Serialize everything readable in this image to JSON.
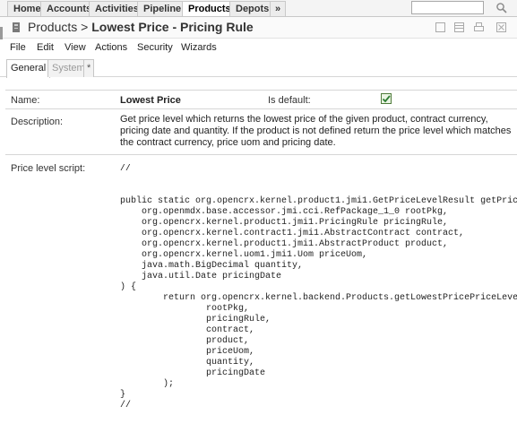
{
  "nav": {
    "tabs": [
      "Home",
      "Accounts",
      "Activities",
      "Pipeline",
      "Products",
      "Depots",
      "»"
    ],
    "active": "Products",
    "search_value": ""
  },
  "header": {
    "breadcrumb_parent": "Products",
    "separator": ">",
    "title": "Lowest Price - Pricing Rule"
  },
  "menu": {
    "items": [
      "File",
      "Edit",
      "View",
      "Actions",
      "Security",
      "Wizards"
    ]
  },
  "subtabs": {
    "items": [
      "General",
      "System",
      "*"
    ],
    "active": "General"
  },
  "fields": {
    "name_label": "Name:",
    "name_value": "Lowest Price",
    "is_default_label": "Is default:",
    "is_default_checked": true,
    "description_label": "Description:",
    "description_value": "Get price level which returns the lowest price of the given product, contract currency, pricing date and quantity. If the product is not defined return the price level which matches the contract currency, price uom and pricing date.",
    "script_label": "Price level script:",
    "script_value": "//\n\n\npublic static org.opencrx.kernel.product1.jmi1.GetPriceLevelResult getPriceLevel(\n    org.openmdx.base.accessor.jmi.cci.RefPackage_1_0 rootPkg,\n    org.opencrx.kernel.product1.jmi1.PricingRule pricingRule,\n    org.opencrx.kernel.contract1.jmi1.AbstractContract contract,\n    org.opencrx.kernel.product1.jmi1.AbstractProduct product,\n    org.opencrx.kernel.uom1.jmi1.Uom priceUom,\n    java.math.BigDecimal quantity,\n    java.util.Date pricingDate\n) {\n        return org.opencrx.kernel.backend.Products.getLowestPricePriceLevel(\n                rootPkg,\n                pricingRule,\n                contract,\n                product,\n                priceUom,\n                quantity,\n                pricingDate\n        );\n}\n//"
  },
  "colors": {
    "accent_check": "#2e7d32",
    "border": "#d6d6d6"
  }
}
